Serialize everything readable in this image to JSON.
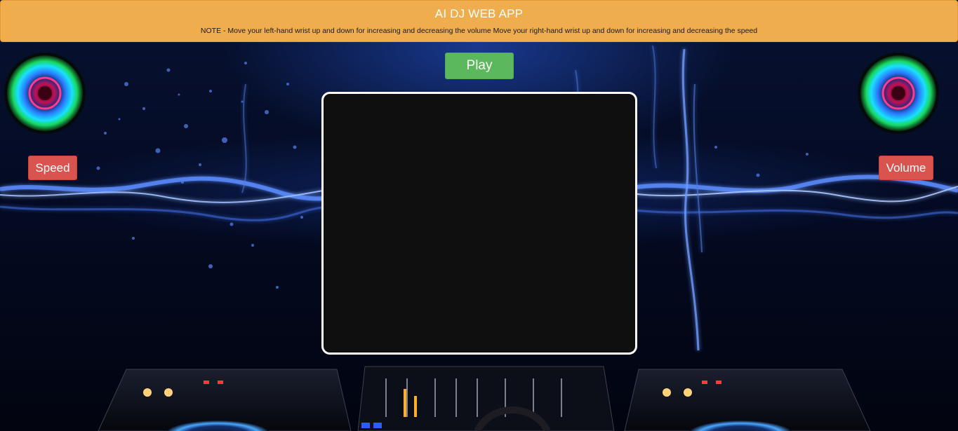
{
  "header": {
    "title": "AI DJ WEB APP",
    "note": "NOTE - Move your left-hand wrist up and down for increasing and decreasing the volume Move your right-hand wrist up and down for increasing and decreasing the speed"
  },
  "controls": {
    "play_label": "Play",
    "speed_label": "Speed",
    "volume_label": "Volume"
  },
  "colors": {
    "header_bg": "#f0ad4e",
    "play_button": "#5cb85c",
    "label_buttons": "#d9534f",
    "video_border": "#ffffff"
  },
  "icons": {
    "left_speaker": "neon-speaker-icon",
    "right_speaker": "neon-speaker-icon"
  }
}
